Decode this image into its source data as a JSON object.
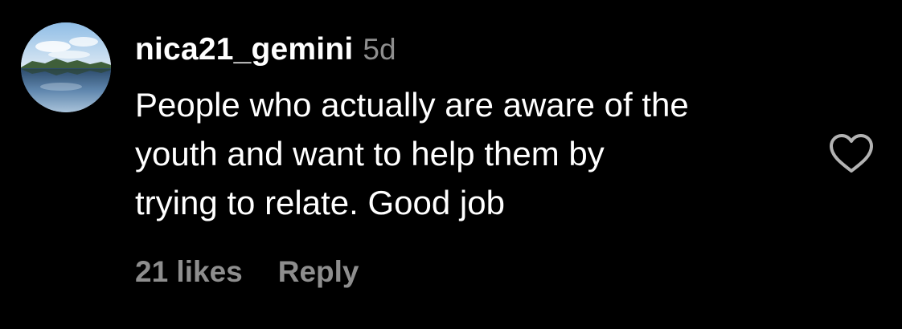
{
  "comment": {
    "username": "nica21_gemini",
    "timestamp": "5d",
    "text_lines": [
      "People who actually are aware of the",
      "youth and want to help them by",
      "trying to relate. Good job"
    ],
    "likes": "21 likes",
    "reply_label": "Reply",
    "like_icon": "heart-outline-icon",
    "avatar_icon": "lake-landscape-avatar"
  },
  "colors": {
    "background": "#000000",
    "primary_text": "#ffffff",
    "secondary_text": "#8e8e8e",
    "icon": "#b3b3b3"
  }
}
